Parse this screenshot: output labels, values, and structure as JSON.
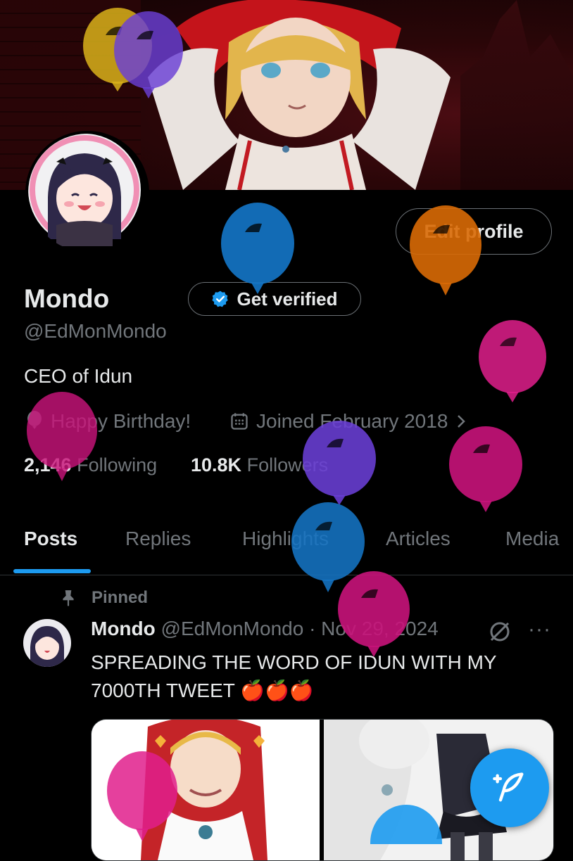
{
  "profile": {
    "display_name": "Mondo",
    "handle": "@EdMonMondo",
    "bio": "CEO of Idun",
    "birthday_text": "Happy Birthday!",
    "joined_text": "Joined February 2018",
    "following_count": "2,146",
    "following_label": "Following",
    "followers_count": "10.8K",
    "followers_label": "Followers"
  },
  "actions": {
    "edit_profile": "Edit profile",
    "get_verified": "Get verified"
  },
  "tabs": [
    {
      "label": "Posts",
      "active": true
    },
    {
      "label": "Replies"
    },
    {
      "label": "Highlights"
    },
    {
      "label": "Articles"
    },
    {
      "label": "Media"
    }
  ],
  "pinned_post": {
    "pinned_label": "Pinned",
    "author_name": "Mondo",
    "author_handle_date": "@EdMonMondo · Nov 29, 2024",
    "more": "···",
    "text_line1": "SPREADING THE WORD OF IDUN WITH MY",
    "text_line2": "7000TH TWEET 🍎🍎🍎"
  },
  "colors": {
    "accent": "#1d9bf0",
    "text_primary": "#e7e9ea",
    "text_secondary": "#71767b",
    "balloon_yellow": "#d9b21a",
    "balloon_purple": "#6a3fd6",
    "balloon_blue": "#1474c4",
    "balloon_orange": "#d96a06",
    "balloon_pink": "#e01e8c",
    "balloon_magenta": "#c8137a"
  },
  "icons": [
    "verified-badge-icon",
    "balloon-icon",
    "calendar-icon",
    "chevron-right-icon",
    "pin-icon",
    "grok-icon",
    "more-icon",
    "compose-icon"
  ]
}
